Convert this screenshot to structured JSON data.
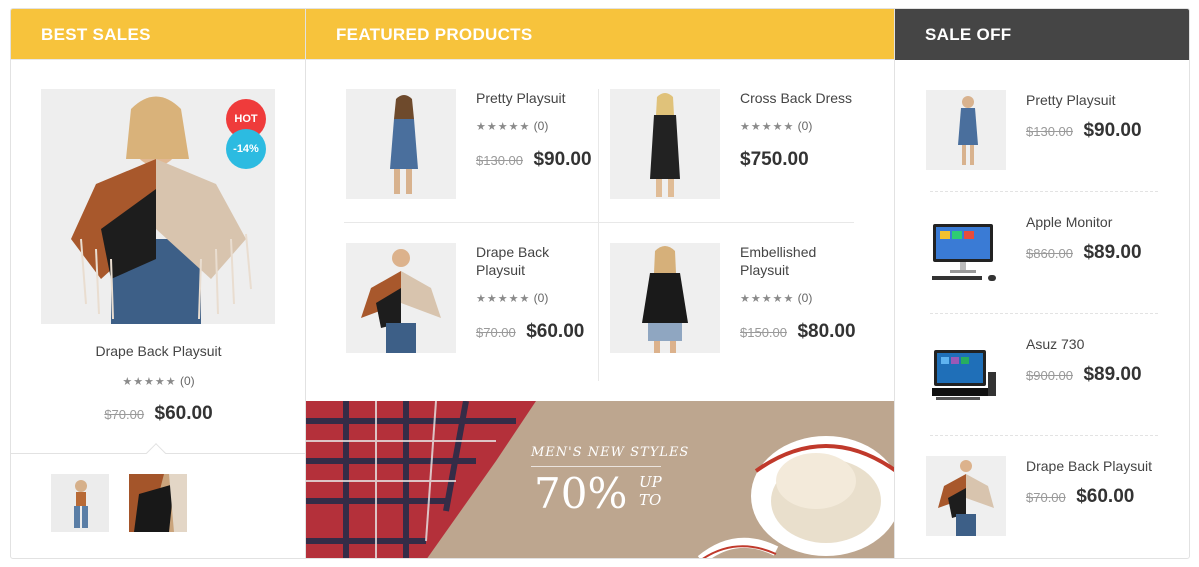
{
  "best_sales": {
    "header": "BEST SALES",
    "badges": {
      "hot": "HOT",
      "discount": "-14%"
    },
    "product": {
      "name": "Drape Back Playsuit",
      "rating": "(0)",
      "old_price": "$70.00",
      "price": "$60.00"
    }
  },
  "featured": {
    "header": "FEATURED PRODUCTS",
    "products": [
      {
        "name": "Pretty Playsuit",
        "rating": "(0)",
        "old_price": "$130.00",
        "price": "$90.00"
      },
      {
        "name": "Cross Back Dress",
        "rating": "(0)",
        "old_price": "",
        "price": "$750.00"
      },
      {
        "name": "Drape Back Playsuit",
        "rating": "(0)",
        "old_price": "$70.00",
        "price": "$60.00"
      },
      {
        "name": "Embellished Playsuit",
        "rating": "(0)",
        "old_price": "$150.00",
        "price": "$80.00"
      }
    ],
    "banner": {
      "subtitle": "MEN'S NEW STYLES",
      "big": "70%",
      "up": "UP",
      "to": "TO"
    }
  },
  "sale_off": {
    "header": "SALE OFF",
    "products": [
      {
        "name": "Pretty Playsuit",
        "old_price": "$130.00",
        "price": "$90.00"
      },
      {
        "name": "Apple Monitor",
        "old_price": "$860.00",
        "price": "$89.00"
      },
      {
        "name": "Asuz 730",
        "old_price": "$900.00",
        "price": "$89.00"
      },
      {
        "name": "Drape Back Playsuit",
        "old_price": "$70.00",
        "price": "$60.00"
      }
    ]
  },
  "stars": "★★★★★",
  "colors": {
    "header_yellow": "#f7c33c",
    "header_dark": "#454545",
    "hot_badge": "#ef3b3b",
    "discount_badge": "#2cbbe1"
  }
}
